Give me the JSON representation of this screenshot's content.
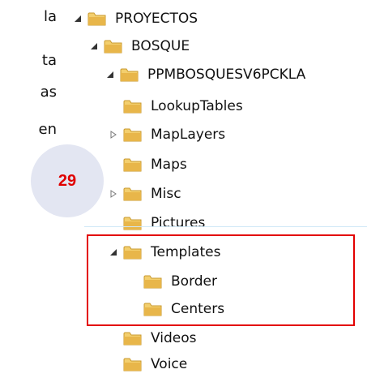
{
  "left_fragments": [
    "la",
    "ta",
    "as",
    "en"
  ],
  "badge": {
    "number": "29"
  },
  "tree": {
    "items": [
      {
        "label": "PROYECTOS",
        "expanded": true
      },
      {
        "label": "BOSQUE",
        "expanded": true
      },
      {
        "label": "PPMBOSQUESV6PCKLA",
        "expanded": true
      },
      {
        "label": "LookupTables",
        "expanded": false
      },
      {
        "label": "MapLayers",
        "expanded": false
      },
      {
        "label": "Maps",
        "expanded": false
      },
      {
        "label": "Misc",
        "expanded": false
      },
      {
        "label": "Pictures",
        "expanded": false
      },
      {
        "label": "Templates",
        "expanded": true
      },
      {
        "label": "Border",
        "expanded": false
      },
      {
        "label": "Centers",
        "expanded": false
      },
      {
        "label": "Videos",
        "expanded": false
      },
      {
        "label": "Voice",
        "expanded": false
      }
    ]
  },
  "colors": {
    "highlight_border": "#e30000",
    "badge_background": "#e3e6f2",
    "badge_text": "#e00000",
    "folder": "#e8b64a"
  }
}
